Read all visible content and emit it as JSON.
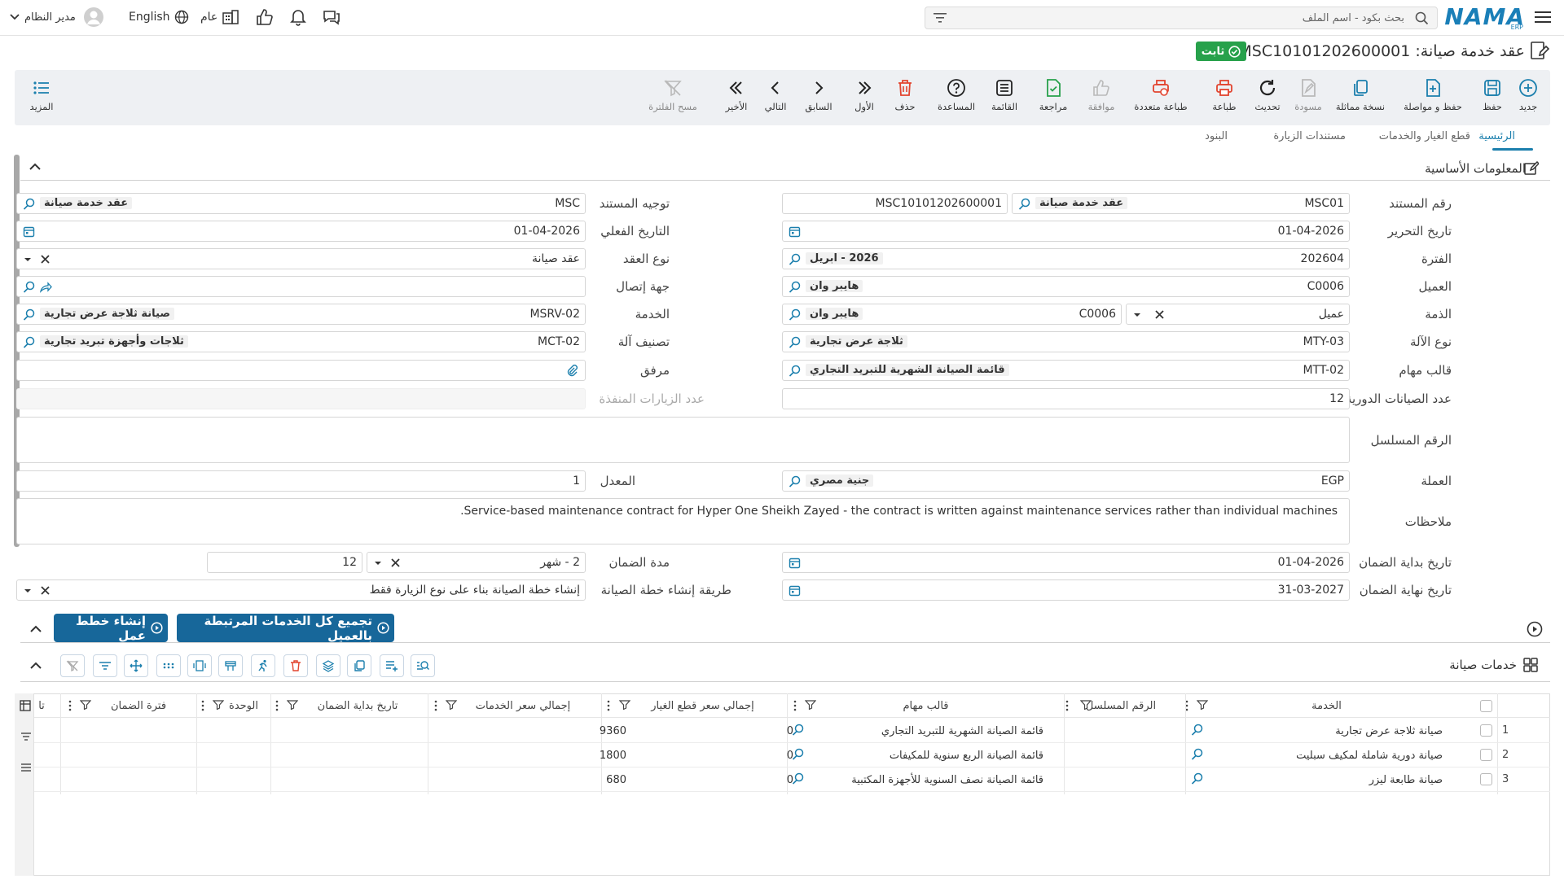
{
  "topbar": {
    "logo": "NAMA",
    "logo_sub": "ERP",
    "search_placeholder": "بحث بكود - اسم الملف",
    "user_name": "مدير النظام",
    "language": "English",
    "scope": "عام"
  },
  "header": {
    "title": "عقد خدمة صيانة: MSC10101202600001",
    "status_badge": "ثابت"
  },
  "toolbar": {
    "new": "جديد",
    "save": "حفظ",
    "save_continue": "حفظ و مواصلة",
    "copy": "نسخة مماثلة",
    "draft": "مسودة",
    "refresh": "تحديث",
    "print": "طباعة",
    "multi_print": "طباعة متعددة",
    "approve": "موافقة",
    "review": "مراجعة",
    "list": "القائمة",
    "help": "المساعدة",
    "delete": "حذف",
    "first": "الأول",
    "previous": "السابق",
    "next": "التالي",
    "last": "الأخير",
    "clear_filter": "مسح الفلترة",
    "more": "المزيد"
  },
  "tabs": [
    "الرئيسية",
    "قطع الغيار والخدمات",
    "مستندات الزيارة",
    "البنود"
  ],
  "section": {
    "title": "المعلومات الأساسية"
  },
  "labels": {
    "doc_number": "رقم المستند",
    "doc_direction": "توجيه المستند",
    "edit_date": "تاريخ التحرير",
    "actual_date": "التاريخ الفعلي",
    "period": "الفترة",
    "contract_type": "نوع العقد",
    "customer": "العميل",
    "contact": "جهة إتصال",
    "account": "الذمة",
    "service": "الخدمة",
    "machine_type": "نوع الآلة",
    "machine_class": "تصنيف آلة",
    "task_template": "قالب مهام",
    "attachment": "مرفق",
    "periodic_count": "عدد الصيانات الدورية",
    "visits_done": "عدد الزيارات المنفذة",
    "serial": "الرقم المسلسل",
    "currency": "العملة",
    "rate": "المعدل",
    "notes": "ملاحظات",
    "warranty_start": "تاريخ بداية الضمان",
    "warranty_period": "مدة الضمان",
    "warranty_end": "تاريخ نهاية الضمان",
    "plan_method": "طريقة إنشاء خطة الصيانة"
  },
  "values": {
    "doc_code": "MSC01",
    "doc_code_desc": "عقد خدمة صيانة",
    "doc_number": "MSC10101202600001",
    "direction_code": "MSC",
    "direction_desc": "عقد خدمة صيانة",
    "edit_date": "01-04-2026",
    "actual_date": "01-04-2026",
    "period_code": "202604",
    "period_desc": "2026 - ابريل",
    "contract_type": "عقد صيانة",
    "customer_code": "C0006",
    "customer_desc": "هايبر وان",
    "account_type": "عميل",
    "account_code": "C0006",
    "account_desc": "هايبر وان",
    "service_code": "MSRV-02",
    "service_desc": "صيانة ثلاجة عرض تجارية",
    "machine_type_code": "MTY-03",
    "machine_type_desc": "ثلاجة عرض تجارية",
    "machine_class_code": "MCT-02",
    "machine_class_desc": "ثلاجات وأجهزة تبريد تجارية",
    "task_template_code": "MTT-02",
    "task_template_desc": "قائمة الصيانة الشهرية للتبريد التجاري",
    "periodic_count": "12",
    "currency_code": "EGP",
    "currency_desc": "جنية مصري",
    "rate": "1",
    "notes": "Service-based maintenance contract for Hyper One Sheikh Zayed - the contract is written against maintenance services rather than individual machines.",
    "warranty_start": "01-04-2026",
    "warranty_period_unit": "2 - شهر",
    "warranty_period_value": "12",
    "warranty_end": "31-03-2027",
    "plan_method": "إنشاء خطة الصيانة بناء على نوع الزيارة فقط"
  },
  "actions": {
    "create_plans": "إنشاء خطط عمل",
    "group_services": "تجميع كل الخدمات المرتبطة بالعميل"
  },
  "grid": {
    "title": "خدمات صيانة",
    "columns": [
      "الخدمة",
      "الرقم المسلسل",
      "قالب مهام",
      "إجمالي سعر قطع الغيار",
      "إجمالي سعر الخدمات",
      "تاريخ بداية الضمان",
      "الوحدة",
      "فترة الضمان",
      "تا"
    ],
    "rows": [
      {
        "num": "1",
        "service": "صيانة ثلاجة عرض تجارية",
        "template": "قائمة الصيانة الشهرية للتبريد التجاري",
        "parts_total": "0",
        "services_total": "9360"
      },
      {
        "num": "2",
        "service": "صيانة دورية شاملة لمكيف سبليت",
        "template": "قائمة الصيانة الربع سنوية للمكيفات",
        "parts_total": "0",
        "services_total": "1800"
      },
      {
        "num": "3",
        "service": "صيانة طابعة ليزر",
        "template": "قائمة الصيانة نصف السنوية للأجهزة المكتبية",
        "parts_total": "0",
        "services_total": "680"
      }
    ]
  },
  "colors": {
    "accent": "#1b7fad",
    "primary_button": "#17679a",
    "status_green": "#27a14b",
    "logo": "#1a7fb8"
  }
}
